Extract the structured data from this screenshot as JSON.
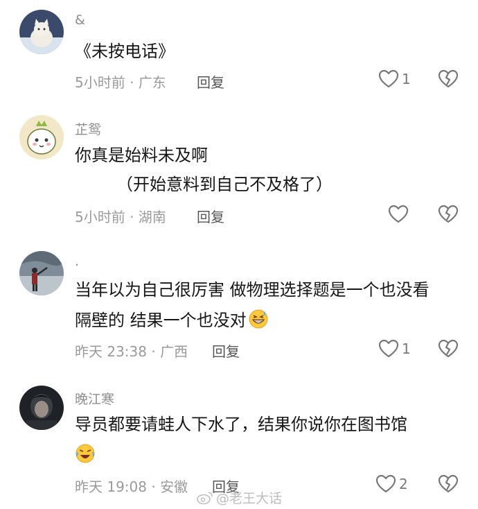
{
  "comments": [
    {
      "username": "&",
      "lines": [
        "《未按电话》"
      ],
      "time_location": "5小时前 · 广东",
      "reply_label": "回复",
      "likes": "1",
      "avatar_icon": "cat-avatar"
    },
    {
      "username": "芷鸳",
      "lines": [
        "你真是始料未及啊",
        "（开始意料到自己不及格了）"
      ],
      "time_location": "5小时前 · 湖南",
      "reply_label": "回复",
      "likes": "",
      "avatar_icon": "cartoon-cat-crown-avatar"
    },
    {
      "username": ".",
      "lines": [
        "当年以为自己很厉害 做物理选择题是一个也没看",
        "隔壁的 结果一个也没对"
      ],
      "time_location": "昨天 23:38 · 广西",
      "reply_label": "回复",
      "likes": "1",
      "avatar_icon": "person-silhouette-avatar"
    },
    {
      "username": "晚江寒",
      "lines": [
        "导员都要请蛙人下水了，结果你说你在图书馆",
        ""
      ],
      "time_location": "昨天 19:08 · 安徽",
      "reply_label": "回复",
      "likes": "2",
      "avatar_icon": "dark-portrait-avatar"
    }
  ],
  "watermark": {
    "text": "@老王大话",
    "icon": "weibo-icon"
  },
  "colors": {
    "username": "#8e8e8e",
    "text": "#161616",
    "meta": "#9a9a9a",
    "icon": "#777777"
  }
}
